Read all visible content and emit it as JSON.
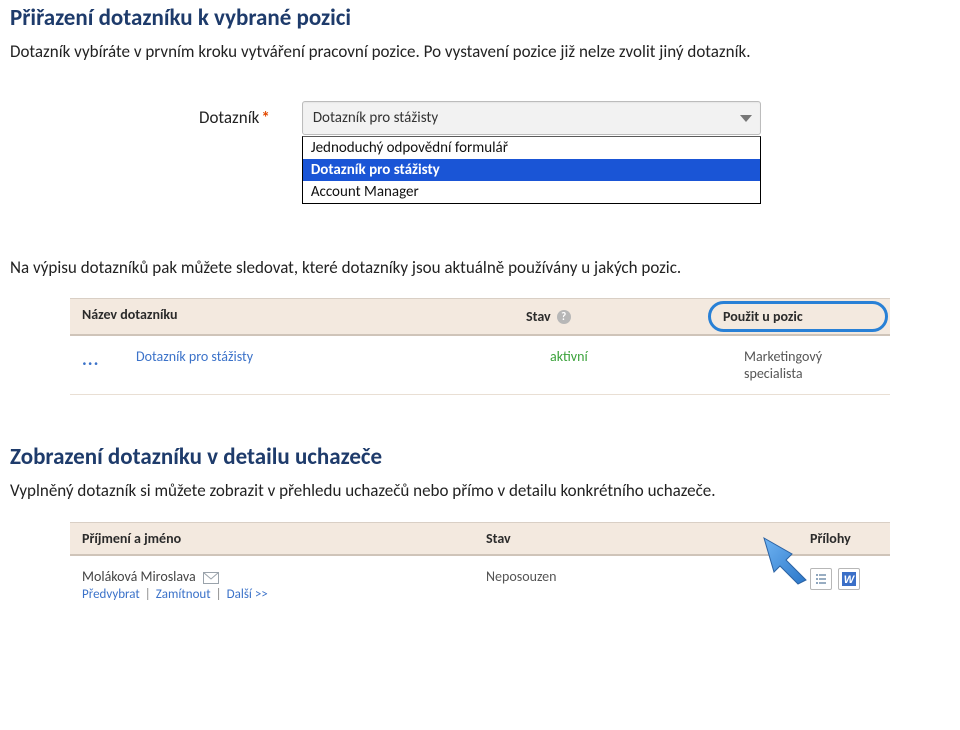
{
  "section1": {
    "heading": "Přiřazení dotazníku k vybrané pozici",
    "paragraph": "Dotazník vybíráte v prvním kroku vytváření pracovní pozice. Po vystavení pozice již nelze zvolit jiný dotazník.",
    "field_label": "Dotazník",
    "selected_value": "Dotazník pro stážisty",
    "options": {
      "o0": "Jednoduchý odpovědní formulář",
      "o1": "Dotazník pro stážisty",
      "o2": "Account Manager"
    }
  },
  "section2": {
    "paragraph": "Na výpisu dotazníků pak můžete sledovat, které dotazníky jsou aktuálně používány u jakých pozic.",
    "headers": {
      "name": "Název dotazníku",
      "state": "Stav",
      "used": "Použit u pozic"
    },
    "row": {
      "dots": "...",
      "name": "Dotazník pro stážisty",
      "state": "aktivní",
      "used": "Marketingový specialista"
    }
  },
  "section3": {
    "heading": "Zobrazení dotazníku v detailu uchazeče",
    "paragraph": "Vyplněný dotazník si můžete zobrazit v přehledu uchazečů nebo přímo v detailu konkrétního uchazeče.",
    "headers": {
      "name": "Příjmení a jméno",
      "state": "Stav",
      "attachments": "Přílohy"
    },
    "row": {
      "name": "Moláková Miroslava",
      "state": "Neposouzen",
      "actions": {
        "preselect": "Předvybrat",
        "reject": "Zamítnout",
        "more": "Další >>"
      }
    }
  }
}
